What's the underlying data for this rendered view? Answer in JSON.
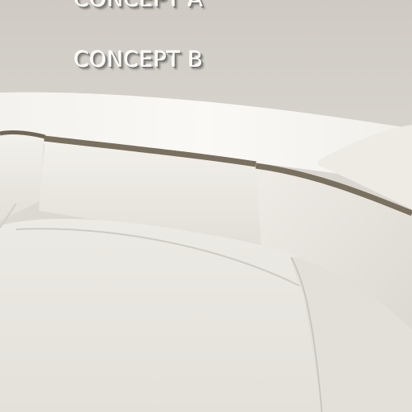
{
  "wall_text": {
    "concept_a": "CONCEPT A",
    "concept_b": "CONCEPT B"
  },
  "colors": {
    "wall": "#d9d6d0",
    "cushion": "#ebe9e3",
    "piping": "#7a7060",
    "seat": "#e6e4de"
  }
}
